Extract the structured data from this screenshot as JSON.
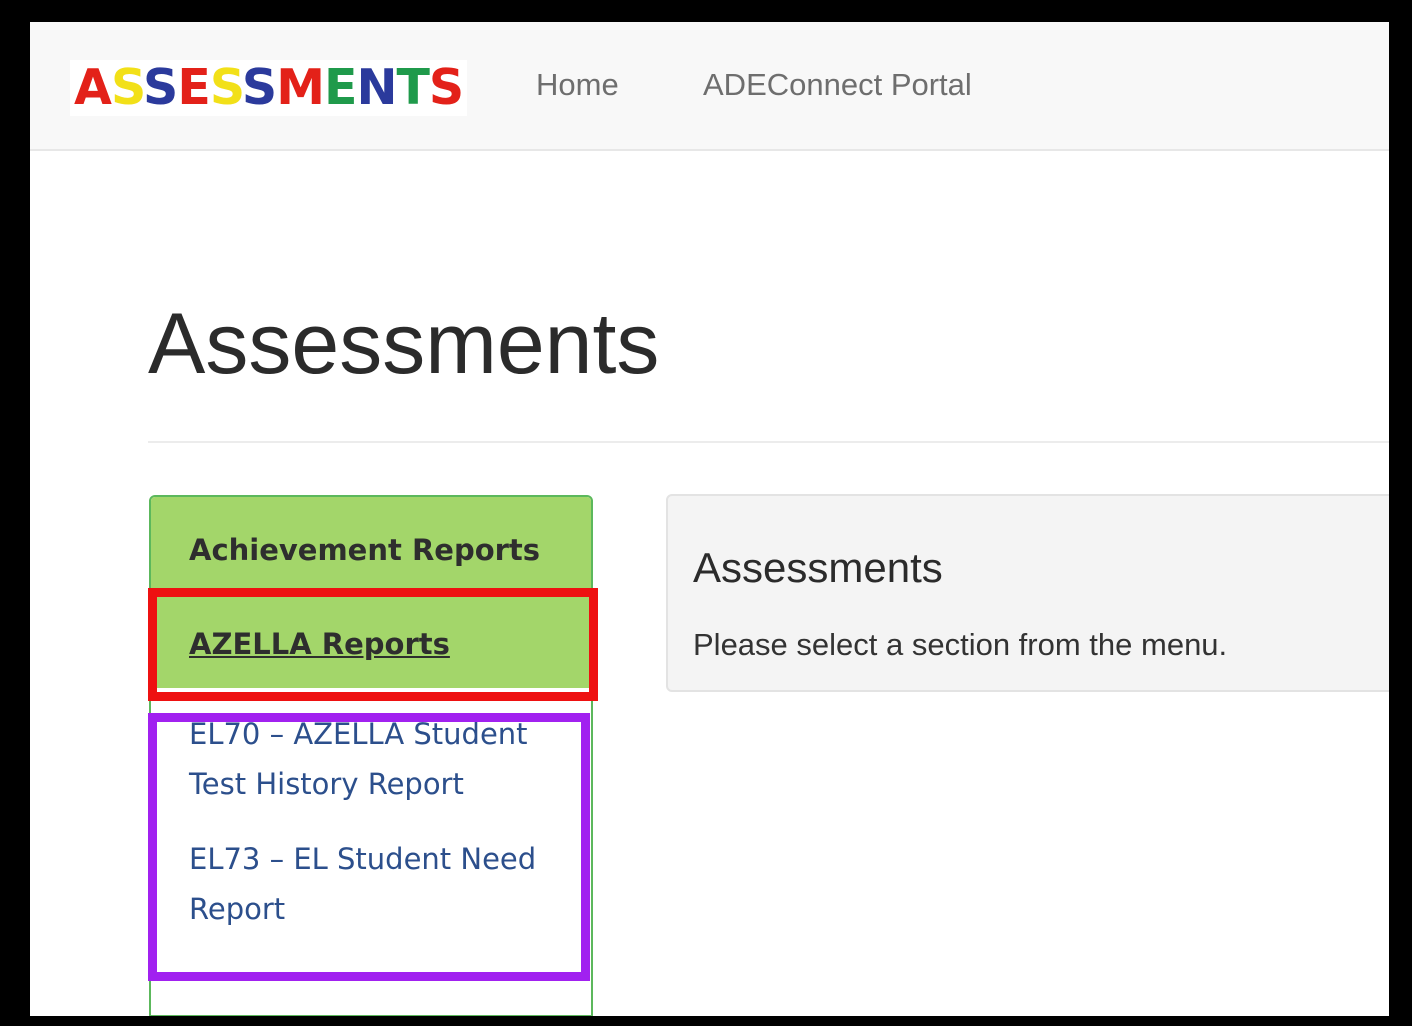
{
  "navbar": {
    "logo": {
      "letters": [
        {
          "char": "A",
          "color": "#e32119"
        },
        {
          "char": "S",
          "color": "#f2e018"
        },
        {
          "char": "S",
          "color": "#2b3a9c"
        },
        {
          "char": "E",
          "color": "#e32119"
        },
        {
          "char": "S",
          "color": "#f2e018"
        },
        {
          "char": "S",
          "color": "#2b3a9c"
        },
        {
          "char": "M",
          "color": "#e32119"
        },
        {
          "char": "E",
          "color": "#1f9a4b"
        },
        {
          "char": "N",
          "color": "#2b3a9c"
        },
        {
          "char": "T",
          "color": "#1f9a4b"
        },
        {
          "char": "S",
          "color": "#e32119"
        }
      ]
    },
    "links": {
      "home": "Home",
      "portal": "ADEConnect Portal"
    }
  },
  "page": {
    "title": "Assessments"
  },
  "sidebar": {
    "achievement_reports": "Achievement Reports",
    "azella_reports": "AZELLA Reports",
    "sub_links": {
      "el70": "EL70 – AZELLA Student Test History Report",
      "el73": "EL73 – EL Student Need Report"
    }
  },
  "welcome": {
    "title": "Assessments",
    "text": "Please select a section from the menu."
  },
  "colors": {
    "menu_green": "#a3d66a",
    "menu_border": "#5cb85c",
    "link_blue": "#2c4f8c",
    "highlight_red": "#ee1111",
    "highlight_purple": "#a121f0"
  }
}
